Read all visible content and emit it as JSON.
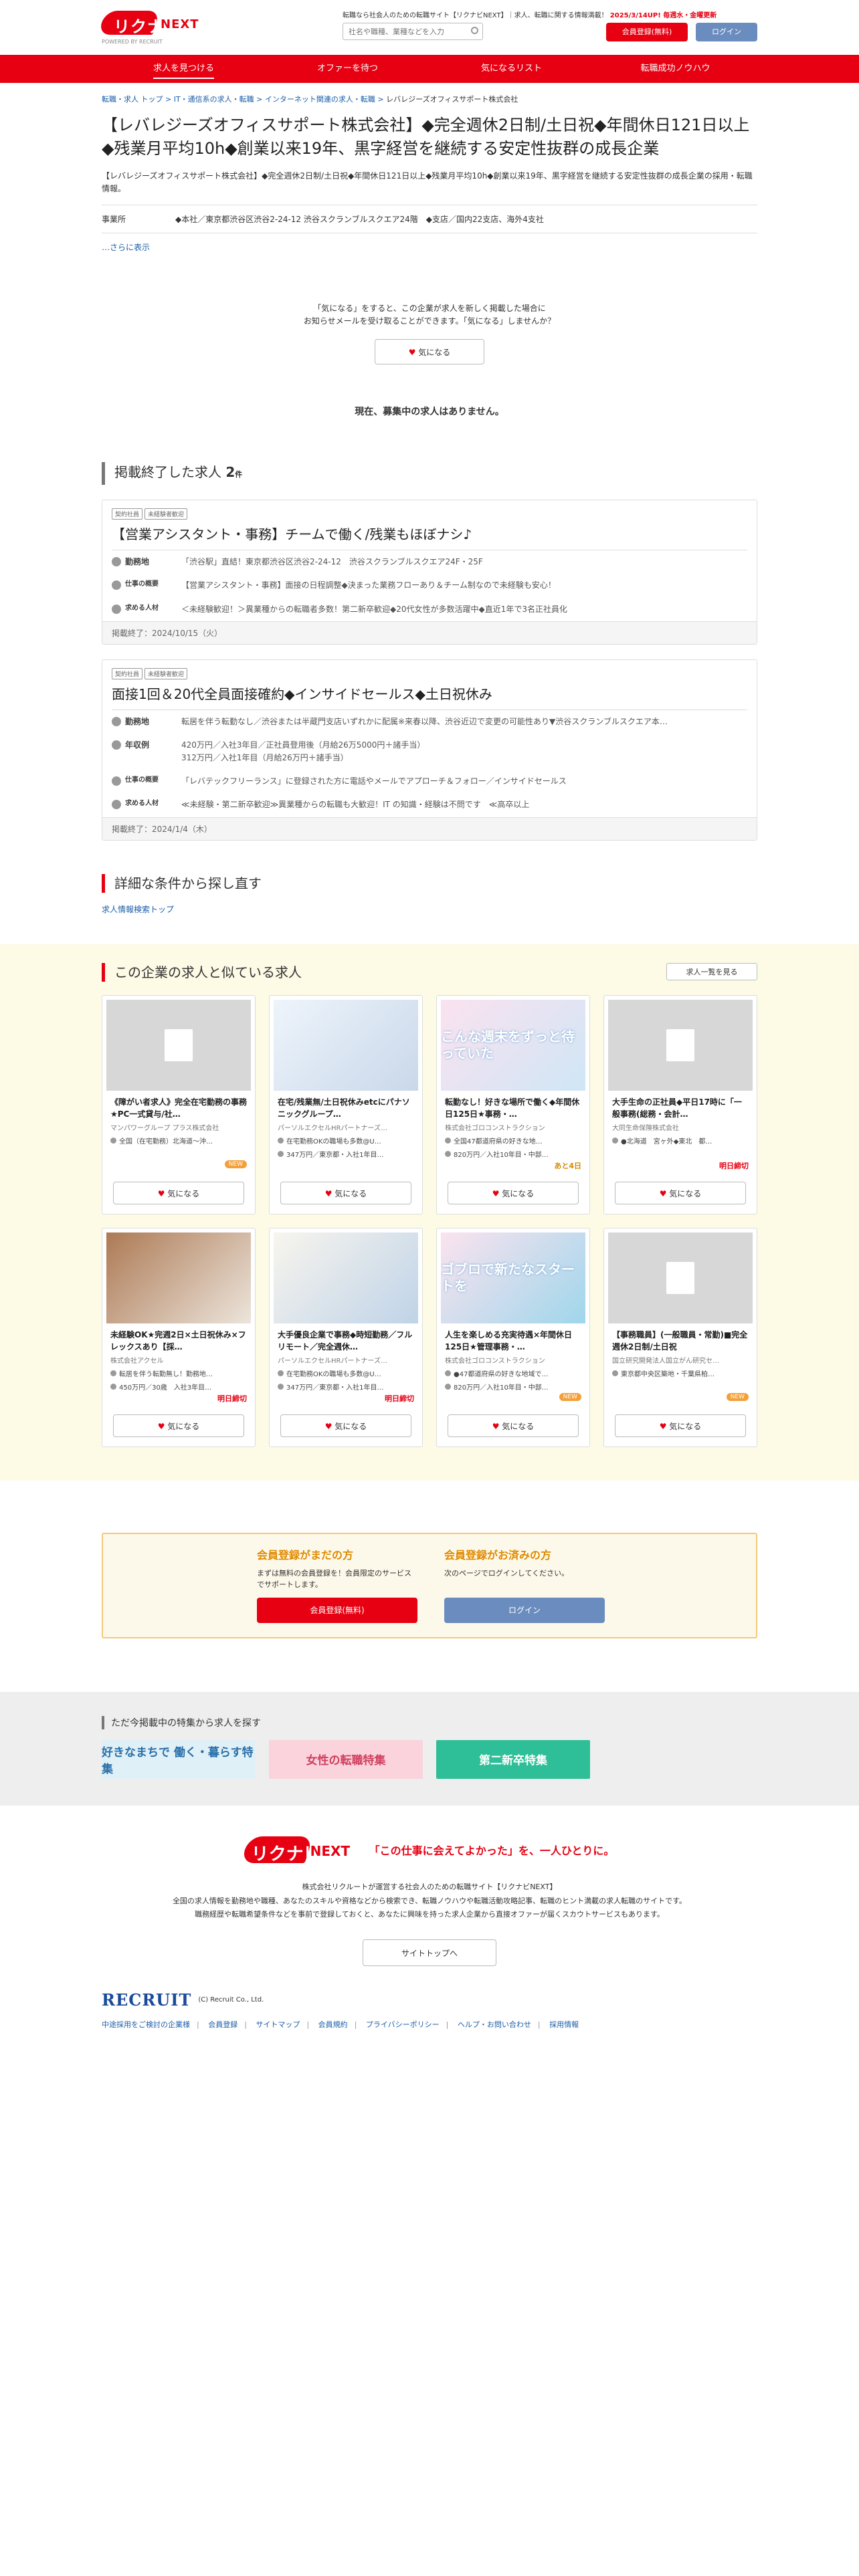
{
  "header": {
    "logo_main": "リクナビ",
    "logo_next": "NEXT",
    "powered": "POWERED BY RECRUIT",
    "tagline": "転職なら社会人のための転職サイト【リクナビNEXT】｜求人、転職に関する情報満載！",
    "update": "2025/3/14UP! 毎週水・金曜更新",
    "search_placeholder": "社名や職種、業種などを入力",
    "register_btn": "会員登録(無料)",
    "login_btn": "ログイン"
  },
  "nav": [
    "求人を見つける",
    "オファーを待つ",
    "気になるリスト",
    "転職成功ノウハウ"
  ],
  "breadcrumb": [
    "転職・求人 トップ",
    "IT・通信系の求人・転職",
    "インターネット関連の求人・転職",
    "レバレジーズオフィスサポート株式会社"
  ],
  "company": {
    "title": "【レバレジーズオフィスサポート株式会社】◆完全週休2日制/土日祝◆年間休日121日以上◆残業月平均10h◆創業以来19年、黒字経営を継続する安定性抜群の成長企業",
    "desc": "【レバレジーズオフィスサポート株式会社】◆完全週休2日制/土日祝◆年間休日121日以上◆残業月平均10h◆創業以来19年、黒字経営を継続する安定性抜群の成長企業の採用・転職情報。",
    "office_label": "事業所",
    "office_value": "◆本社／東京都渋谷区渋谷2-24-12 渋谷スクランブルスクエア24階　◆支店／国内22支店、海外4支社",
    "show_more": "…さらに表示"
  },
  "favorite": {
    "line1": "「気になる」をすると、この企業が求人を新しく掲載した場合に",
    "line2": "お知らせメールを受け取ることができます。「気になる」しませんか？",
    "btn": "気になる"
  },
  "no_jobs": "現在、募集中の求人はありません。",
  "ended": {
    "title": "掲載終了した求人",
    "count": "2",
    "count_unit": "件",
    "jobs": [
      {
        "tags": [
          "契約社員",
          "未経験者歓迎"
        ],
        "title": "【営業アシスタント・事務】チームで働く/残業もほぼナシ♪",
        "rows": [
          {
            "k": "勤務地",
            "v": "「渋谷駅」直結！東京都渋谷区渋谷2-24-12　渋谷スクランブルスクエア24F・25F"
          },
          {
            "k": "仕事の概要",
            "v": "【営業アシスタント・事務】面接の日程調整◆決まった業務フローあり＆チーム制なので未経験も安心！"
          },
          {
            "k": "求める人材",
            "v": "＜未経験歓迎！＞異業種からの転職者多数！第二新卒歓迎◆20代女性が多数活躍中◆直近1年で3名正社員化"
          }
        ],
        "date": "掲載終了：2024/10/15（火）"
      },
      {
        "tags": [
          "契約社員",
          "未経験者歓迎"
        ],
        "title": "面接1回＆20代全員面接確約◆インサイドセールス◆土日祝休み",
        "rows": [
          {
            "k": "勤務地",
            "v": "転居を伴う転勤なし／渋谷または半蔵門支店いずれかに配属※来春以降、渋谷近辺で変更の可能性あり▼渋谷スクランブルスクエア本…"
          },
          {
            "k": "年収例",
            "v": "420万円／入社3年目／正社員登用後（月給26万5000円＋諸手当）"
          },
          {
            "k": "",
            "v": "312万円／入社1年目（月給26万円＋諸手当）"
          },
          {
            "k": "仕事の概要",
            "v": "「レバテックフリーランス」に登録された方に電話やメールでアプローチ＆フォロー／インサイドセールス"
          },
          {
            "k": "求める人材",
            "v": "≪未経験・第二新卒歓迎≫異業種からの転職も大歓迎！IT の知識・経験は不問です　≪高卒以上"
          }
        ],
        "date": "掲載終了：2024/1/4（木）"
      }
    ]
  },
  "detail": {
    "title": "詳細な条件から探し直す",
    "link": "求人情報検索トップ"
  },
  "similar": {
    "title": "この企業の求人と似ている求人",
    "all_btn": "求人一覧を見る",
    "fav_btn": "気になる",
    "cards": [
      {
        "title": "《障がい者求人》完全在宅勤務の事務★PC一式貸与/社…",
        "company": "マンパワーグループ プラス株式会社",
        "line1": "全国（在宅勤務）北海道〜沖…",
        "line2": "",
        "badge": "NEW",
        "badge_type": "new",
        "img": "placeholder"
      },
      {
        "title": "在宅/残業無/土日祝休みetcにパナソニックグループ…",
        "company": "パーソルエクセルHRパートナーズ…",
        "line1": "在宅勤務OKの職場も多数@U…",
        "line2": "347万円／東京都・入社1年目…",
        "badge": "",
        "badge_type": "",
        "img": "photo-a"
      },
      {
        "title": "転勤なし！好きな場所で働く◆年間休日125日★事務・…",
        "company": "株式会社ゴロコンストラクション",
        "line1": "全国47都道府県の好きな地…",
        "line2": "820万円／入社10年目・中部…",
        "badge": "あと4日",
        "badge_type": "days",
        "img": "photo-b",
        "photo_text": "こんな週末をずっと待っていた"
      },
      {
        "title": "大手生命の正社員◆平日17時に「一般事務(総務・会計…",
        "company": "大同生命保険株式会社",
        "line1": "●北海道　宮ヶ外◆東北　都…",
        "line2": "",
        "badge": "明日締切",
        "badge_type": "deadline",
        "img": "placeholder"
      },
      {
        "title": "未経験OK★完週2日×土日祝休み×フレックスあり【採…",
        "company": "株式会社アクセル",
        "line1": "転居を伴う転勤無し！勤務地…",
        "line2": "450万円／30歳　入社3年目…",
        "badge": "明日締切",
        "badge_type": "deadline",
        "img": "photo-c"
      },
      {
        "title": "大手優良企業で事務◆時短勤務／フルリモート／完全週休…",
        "company": "パーソルエクセルHRパートナーズ…",
        "line1": "在宅勤務OKの職場も多数@U…",
        "line2": "347万円／東京都・入社1年目…",
        "badge": "明日締切",
        "badge_type": "deadline",
        "img": "photo-d"
      },
      {
        "title": "人生を楽しめる充実待遇×年間休日125日★管理事務・…",
        "company": "株式会社ゴロコンストラクション",
        "line1": "●47都道府県の好きな地域で…",
        "line2": "820万円／入社10年目・中部…",
        "badge": "NEW",
        "badge_type": "new",
        "img": "photo-e",
        "photo_text": "ゴブロで新たなスタートを"
      },
      {
        "title": "【事務職員】(一般職員・常勤)■完全週休2日制/土日祝",
        "company": "国立研究開発法人国立がん研究セ…",
        "line1": "東京都中央区築地・千葉県柏…",
        "line2": "",
        "badge": "NEW",
        "badge_type": "new",
        "img": "placeholder"
      }
    ]
  },
  "member": {
    "h1": "会員登録がまだの方",
    "p1": "まずは無料の会員登録を！会員限定のサービスでサポートします。",
    "b1": "会員登録(無料)",
    "h2": "会員登録がお済みの方",
    "p2": "次のページでログインしてください。",
    "b2": "ログイン"
  },
  "features": {
    "title": "ただ今掲載中の特集から求人を探す",
    "banners": [
      "好きなまちで 働く・暮らす特集",
      "女性の転職特集",
      "第二新卒特集"
    ]
  },
  "footer": {
    "catch": "「この仕事に会えてよかった」を、一人ひとりに。",
    "desc1": "株式会社リクルートが運営する社会人のための転職サイト【リクナビNEXT】",
    "desc2": "全国の求人情報を勤務地や職種、あなたのスキルや資格などから検索でき、転職ノウハウや転職活動攻略記事、転職のヒント満載の求人転職のサイトです。",
    "desc3": "職務経歴や転職希望条件などを事前で登録しておくと、あなたに興味を持った求人企業から直接オファーが届くスカウトサービスもあります。",
    "top_btn": "サイトトップへ",
    "recruit": "RECRUIT",
    "copyright": "(C) Recruit Co., Ltd.",
    "links": [
      "中途採用をご検討の企業様",
      "会員登録",
      "サイトマップ",
      "会員規約",
      "プライバシーポリシー",
      "ヘルプ・お問い合わせ",
      "採用情報"
    ]
  }
}
